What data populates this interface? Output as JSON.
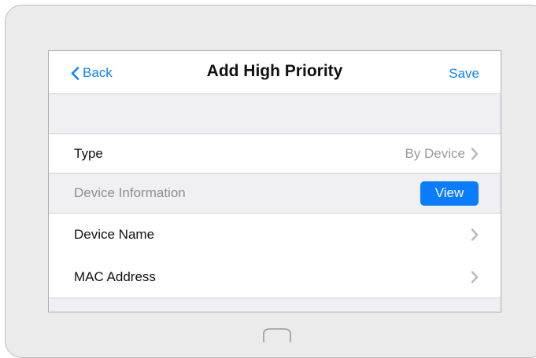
{
  "navbar": {
    "back_label": "Back",
    "title": "Add High Priority",
    "save_label": "Save"
  },
  "rows": {
    "type": {
      "label": "Type",
      "value": "By Device"
    },
    "section": {
      "label": "Device Information",
      "button_label": "View"
    },
    "device_name": {
      "label": "Device Name"
    },
    "mac_address": {
      "label": "MAC Address"
    }
  },
  "colors": {
    "accent": "#0a84ff",
    "button": "#0a7cff",
    "background": "#efeff4",
    "muted_text": "#9b9b9b"
  },
  "icons": [
    "chevron-left-icon",
    "chevron-right-icon",
    "home-button-icon"
  ]
}
